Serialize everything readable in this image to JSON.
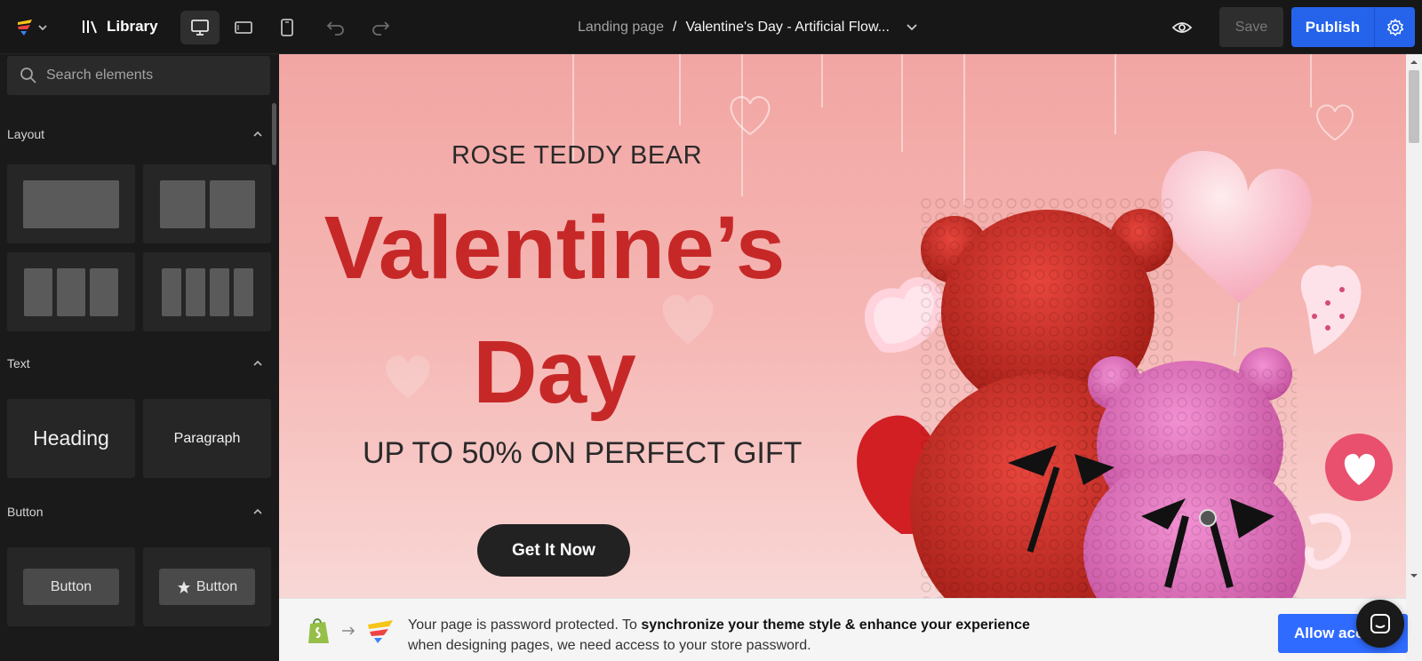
{
  "topbar": {
    "library_label": "Library",
    "breadcrumb_root": "Landing page",
    "breadcrumb_separator": "/",
    "page_title": "Valentine's Day - Artificial Flow...",
    "save_label": "Save",
    "publish_label": "Publish",
    "active_device": "desktop"
  },
  "sidebar": {
    "search_placeholder": "Search elements",
    "sections": [
      {
        "title": "Layout"
      },
      {
        "title": "Text",
        "items": [
          "Heading",
          "Paragraph"
        ]
      },
      {
        "title": "Button",
        "items": [
          "Button",
          "Button"
        ]
      }
    ]
  },
  "hero": {
    "subtitle": "ROSE TEDDY BEAR",
    "title_line1": "Valentine’s",
    "title_line2": "Day",
    "offer": "UP TO 50% ON PERFECT GIFT",
    "cta": "Get It Now"
  },
  "notice": {
    "text_plain1": "Your page is password protected. To ",
    "text_bold": "synchronize your theme style & enhance your experience",
    "text_plain2": "when designing pages, we need access to your store password.",
    "button": "Allow access"
  },
  "colors": {
    "accent": "#2563eb",
    "title_red": "#c62828",
    "canvas_pink": "#f2a6a3"
  }
}
